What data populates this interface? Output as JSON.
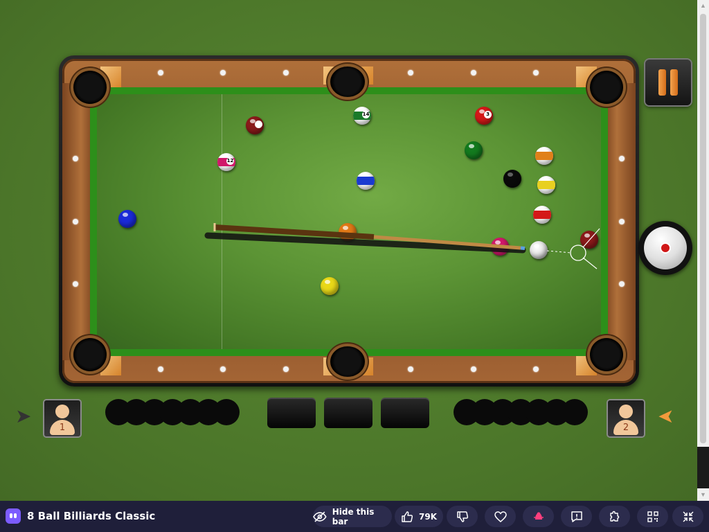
{
  "game": {
    "player1_number": "1",
    "player2_number": "2"
  },
  "icons": {
    "pause": "pause-icon",
    "spin": "cue-ball-spin-icon",
    "turn_left": "turn-arrow-left-icon",
    "turn_right": "turn-arrow-right-icon"
  },
  "colors": {
    "felt": "#5c9435",
    "rail": "#a46535",
    "pause_accent": "#f4a34e",
    "bar_bg": "#1f1f3a",
    "logo": "#7c5cff"
  },
  "bottom_bar": {
    "title": "8 Ball Billiards Classic",
    "hide_label": "Hide this bar",
    "likes": "79K"
  }
}
